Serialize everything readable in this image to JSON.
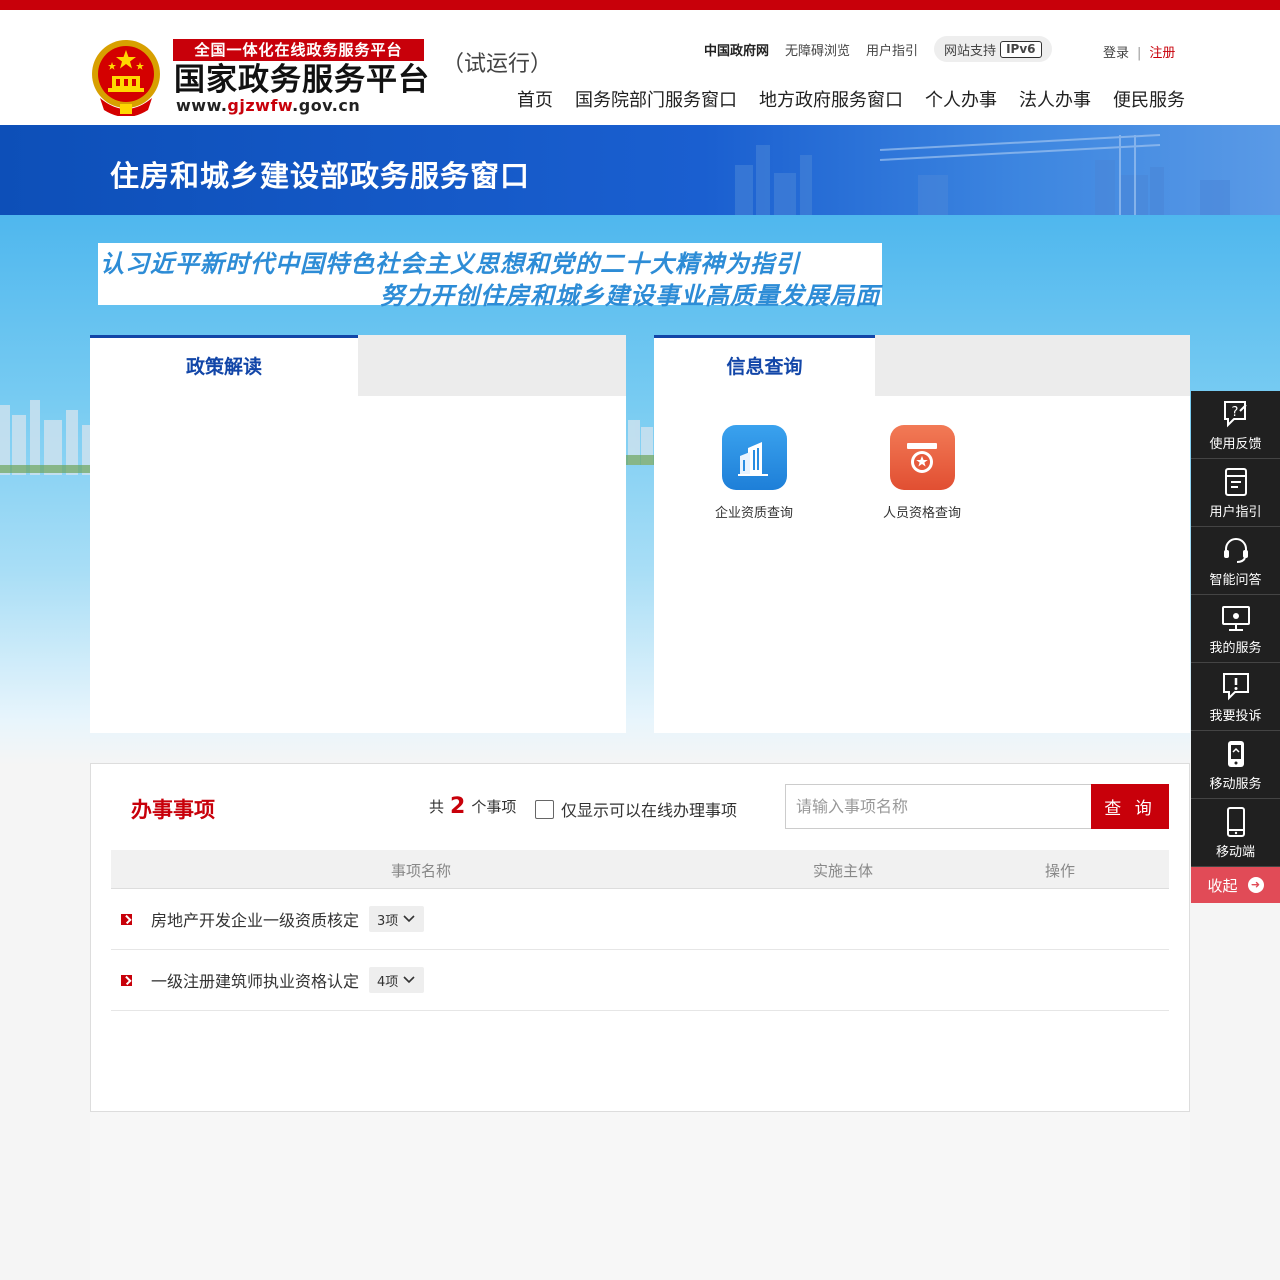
{
  "header": {
    "platform_tag": "全国一体化在线政务服务平台",
    "platform_name": "国家政务服务平台",
    "url_prefix": "www.",
    "url_mid": "gjzwfw",
    "url_suffix": ".gov.cn",
    "trial": "（试运行）",
    "top_links": [
      "中国政府网",
      "无障碍浏览",
      "用户指引"
    ],
    "ipv6_label": "网站支持",
    "ipv6_badge": "IPv6",
    "login": "登录",
    "register": "注册",
    "nav": [
      "首页",
      "国务院部门服务窗口",
      "地方政府服务窗口",
      "个人办事",
      "法人办事",
      "便民服务"
    ]
  },
  "banner": {
    "title": "住房和城乡建设部政务服务窗口",
    "slogan_line1": "认习近平新时代中国特色社会主义思想和党的二十大精神为指引",
    "slogan_line2": "努力开创住房和城乡建设事业高质量发展局面"
  },
  "policy_panel": {
    "tab": "政策解读"
  },
  "info_panel": {
    "tab": "信息查询",
    "items": [
      {
        "label": "企业资质查询",
        "icon": "building-icon"
      },
      {
        "label": "人员资格查询",
        "icon": "certificate-icon"
      }
    ]
  },
  "matters": {
    "title": "办事事项",
    "count_prefix": "共",
    "count": "2",
    "count_suffix": "个事项",
    "online_only_label": "仅显示可以在线办理事项",
    "search_placeholder": "请输入事项名称",
    "search_button": "查 询",
    "columns": [
      "事项名称",
      "实施主体",
      "操作"
    ],
    "rows": [
      {
        "name": "房地产开发企业一级资质核定",
        "count": "3项"
      },
      {
        "name": "一级注册建筑师执业资格认定",
        "count": "4项"
      }
    ]
  },
  "sidebar": {
    "items": [
      "使用反馈",
      "用户指引",
      "智能问答",
      "我的服务",
      "我要投诉",
      "移动服务",
      "移动端"
    ],
    "collapse": "收起"
  },
  "colors": {
    "brand_red": "#c8000a",
    "brand_blue": "#1246a8"
  }
}
